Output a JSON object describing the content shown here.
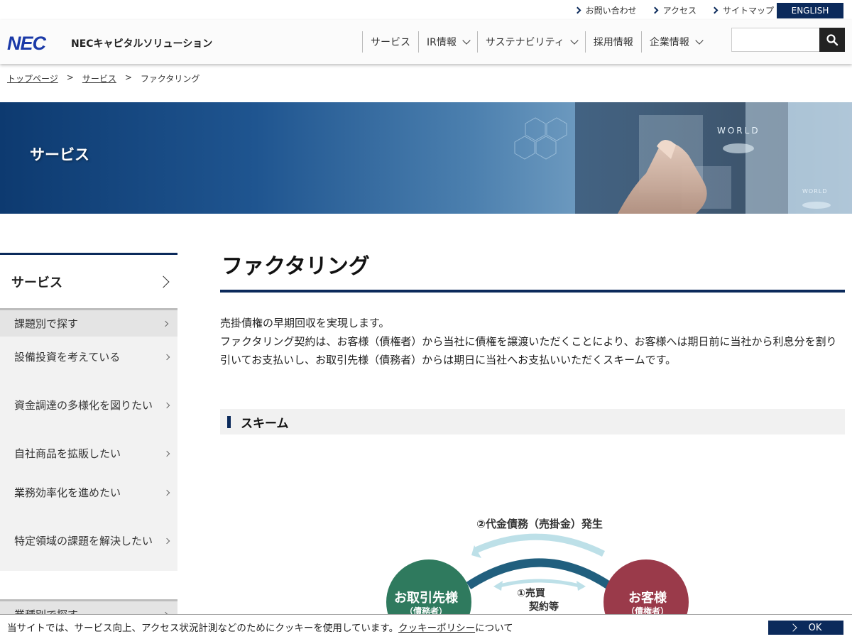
{
  "utility": {
    "links": [
      "お問い合わせ",
      "アクセス",
      "サイトマップ"
    ],
    "english": "ENGLISH"
  },
  "header": {
    "logo": "NEC",
    "company": "NECキャピタルソリューション",
    "nav": [
      {
        "label": "サービス",
        "dropdown": false
      },
      {
        "label": "IR情報",
        "dropdown": true
      },
      {
        "label": "サステナビリティ",
        "dropdown": true
      },
      {
        "label": "採用情報",
        "dropdown": false
      },
      {
        "label": "企業情報",
        "dropdown": true
      }
    ],
    "search_value": ""
  },
  "breadcrumb": [
    "トップページ",
    "サービス",
    "ファクタリング"
  ],
  "hero": {
    "title": "サービス",
    "art_text": [
      "WORLD",
      "WORLD"
    ]
  },
  "sidebar": {
    "top_label": "サービス",
    "category1": "課題別で探す",
    "items": [
      "設備投資を考えている",
      "資金調達の多様化を図りたい",
      "自社商品を拡販したい",
      "業務効率化を進めたい",
      "特定領域の課題を解決したい"
    ],
    "category2": "業種別で探す"
  },
  "main": {
    "title": "ファクタリング",
    "lead1": "売掛債権の早期回収を実現します。",
    "lead2": "ファクタリング契約は、お客様（債権者）から当社に債権を譲渡いただくことにより、お客様へは期日前に当社から利息分を割り引いてお支払いし、お取引先様（債務者）からは期日に当社へお支払いいただくスキームです。",
    "section": "スキーム"
  },
  "diagram": {
    "label_top": "②代金債務（売掛金）発生",
    "label_mid1": "①売買",
    "label_mid2": "契約等",
    "left_title": "お取引先様",
    "left_sub": "（債務者）",
    "right_title": "お客様",
    "right_sub": "（債権者）",
    "colors": {
      "left": "#2f7a5e",
      "right": "#9a3a4a",
      "arc": "#215f7e",
      "arc_light": "#bde0e8"
    }
  },
  "cookie": {
    "before": "当サイトでは、サービス向上、アクセス状況計測などのためにクッキーを使用しています。",
    "policy": "クッキーポリシー",
    "after": "について",
    "ok": "OK"
  }
}
